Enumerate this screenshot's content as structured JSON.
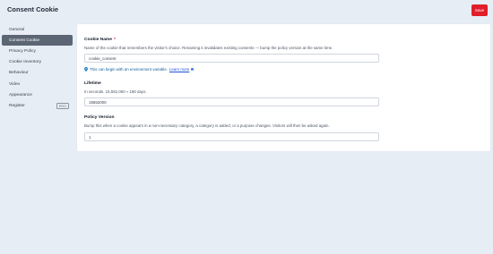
{
  "header": {
    "title": "Consent Cookie",
    "save_label": "Save"
  },
  "sidebar": {
    "items": [
      {
        "label": "General"
      },
      {
        "label": "Consent Cookie",
        "active": true
      },
      {
        "label": "Privacy Policy"
      },
      {
        "label": "Cookie Inventory"
      },
      {
        "label": "Behaviour"
      },
      {
        "label": "Video"
      },
      {
        "label": "Appearance"
      },
      {
        "label": "Register",
        "badge": "PRO"
      }
    ]
  },
  "form": {
    "cookie_name": {
      "label": "Cookie Name",
      "required_mark": "*",
      "description": "Name of the cookie that remembers the visitor's choice. Renaming it invalidates existing consents — bump the policy version at the same time.",
      "value": "cookie_consent",
      "hint_text": "This can begin with an environment variable.",
      "hint_link": "Learn more"
    },
    "lifetime": {
      "label": "Lifetime",
      "description": "In seconds. 15,552,000 ≈ 180 days.",
      "value": "15552000"
    },
    "policy_version": {
      "label": "Policy Version",
      "description": "Bump this when a cookie appears in a non-necessary category, a category is added, or a purpose changes. Visitors will then be asked again.",
      "value": "1"
    }
  },
  "colors": {
    "accent": "#e11d2a",
    "active_nav": "#5b6573",
    "background": "#e7edf4",
    "link": "#1d4ed8"
  },
  "icons": {
    "hint": "map-pin-icon",
    "info": "info-icon"
  }
}
